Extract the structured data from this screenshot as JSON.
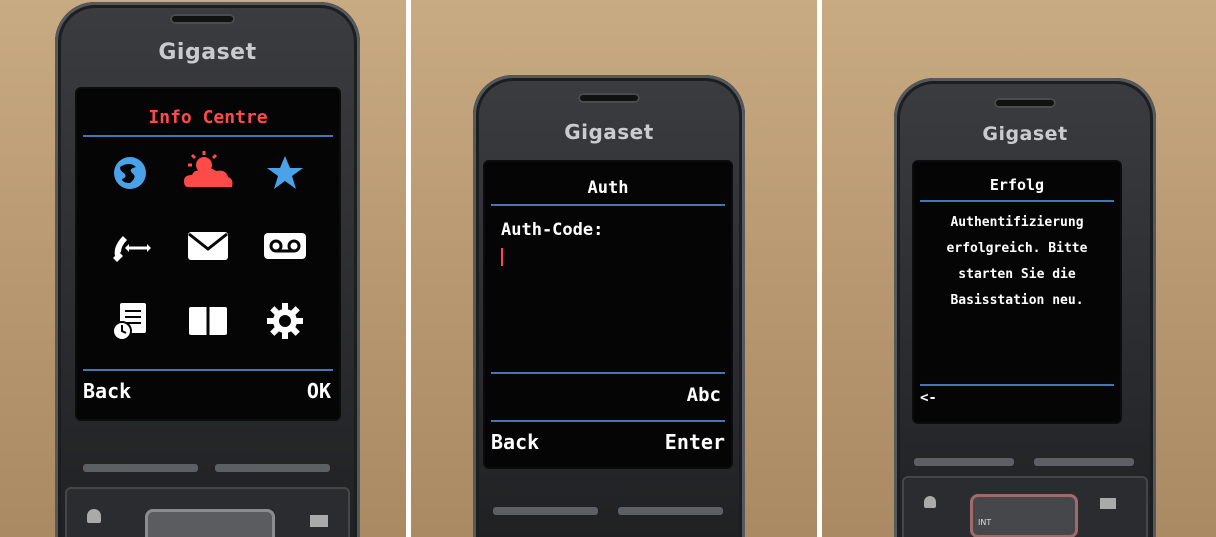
{
  "panel1": {
    "brand": "Gigaset",
    "title": "Info Centre",
    "softkey_left": "Back",
    "softkey_right": "OK",
    "icons": [
      "internet-icon",
      "weather-icon",
      "favorites-star-icon",
      "call-transfer-icon",
      "message-envelope-icon",
      "voicemail-icon",
      "calendar-icon",
      "phonebook-icon",
      "settings-gear-icon"
    ]
  },
  "panel2": {
    "brand": "Gigaset",
    "title": "Auth",
    "field_label": "Auth-Code:",
    "field_value": "",
    "input_mode": "Abc",
    "softkey_left": "Back",
    "softkey_right": "Enter"
  },
  "panel3": {
    "brand": "Gigaset",
    "title": "Erfolg",
    "message_lines": [
      "Authentifizierung",
      "erfolgreich. Bitte",
      "starten Sie die",
      "Basisstation neu."
    ],
    "softkey_left": "<-",
    "keypad_int": "INT"
  },
  "colors": {
    "accent_red": "#ff4a4a",
    "screen_blue": "#3f78b8",
    "icon_blue": "#4aa3e8",
    "screen_bg": "#050506"
  }
}
